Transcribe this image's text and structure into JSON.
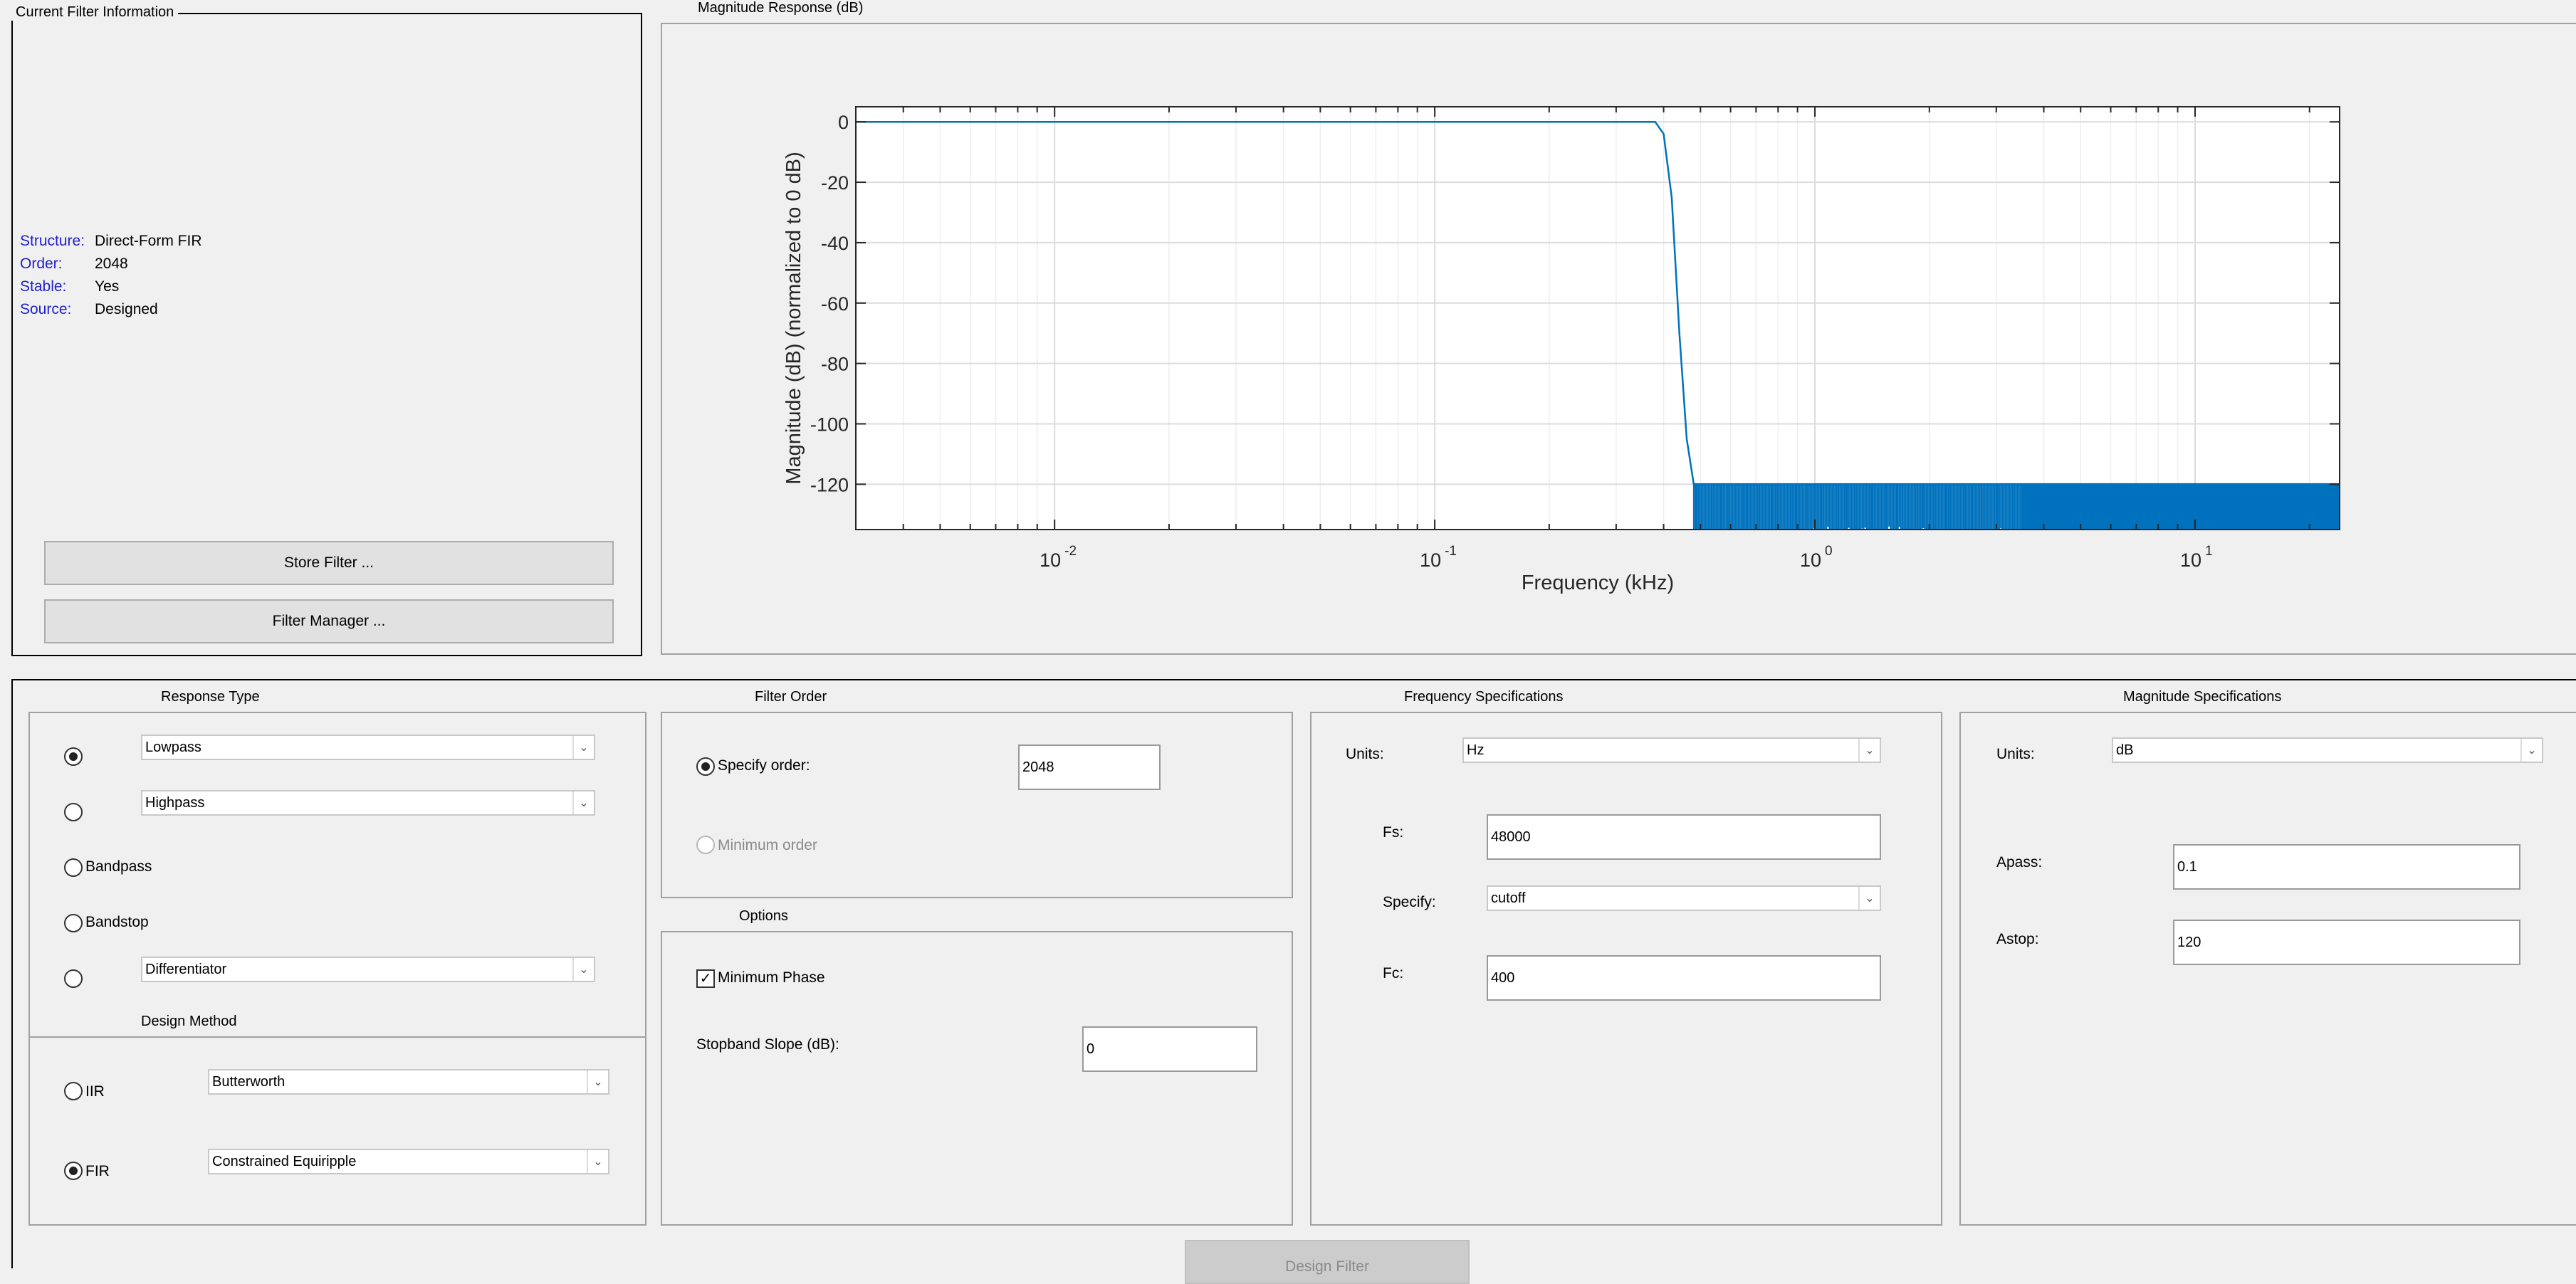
{
  "info_panel": {
    "title": "Current Filter Information",
    "rows": [
      {
        "label": "Structure:",
        "value": "Direct-Form FIR"
      },
      {
        "label": "Order:",
        "value": "2048"
      },
      {
        "label": "Stable:",
        "value": "Yes"
      },
      {
        "label": "Source:",
        "value": "Designed"
      }
    ],
    "store_button": "Store Filter ...",
    "manager_button": "Filter Manager ..."
  },
  "response_panel": {
    "title": "Magnitude Response (dB)"
  },
  "chart_data": {
    "type": "line",
    "xlabel": "Frequency (kHz)",
    "ylabel": "Magnitude (dB) (normalized to 0 dB)",
    "x_scale": "log",
    "xlim": [
      0.003,
      24
    ],
    "ylim": [
      -135,
      5
    ],
    "yticks": [
      0,
      -20,
      -40,
      -60,
      -80,
      -100,
      -120
    ],
    "xticks": [
      {
        "value": 0.01,
        "base": "10",
        "exp": "-2"
      },
      {
        "value": 0.1,
        "base": "10",
        "exp": "-1"
      },
      {
        "value": 1,
        "base": "10",
        "exp": "0"
      },
      {
        "value": 10,
        "base": "10",
        "exp": "1"
      }
    ],
    "grid": true,
    "color": "#0072bd",
    "passband": {
      "from": 0.003,
      "to": 0.38,
      "db": 0
    },
    "transition": [
      [
        0.38,
        0
      ],
      [
        0.4,
        -4
      ],
      [
        0.42,
        -25
      ],
      [
        0.44,
        -70
      ],
      [
        0.46,
        -105
      ],
      [
        0.48,
        -120
      ]
    ],
    "stopband": {
      "from": 0.48,
      "to": 24,
      "top_db": -120,
      "ripple_depth_db": 14
    }
  },
  "response_type": {
    "title": "Response Type",
    "lowpass": "Lowpass",
    "highpass": "Highpass",
    "bandpass": "Bandpass",
    "bandstop": "Bandstop",
    "differentiator": "Differentiator"
  },
  "design_method": {
    "title": "Design Method",
    "iir": "IIR",
    "iir_value": "Butterworth",
    "fir": "FIR",
    "fir_value": "Constrained Equiripple"
  },
  "filter_order": {
    "title": "Filter Order",
    "specify": "Specify order:",
    "specify_value": "2048",
    "minimum": "Minimum order"
  },
  "options": {
    "title": "Options",
    "min_phase": "Minimum Phase",
    "slope_label": "Stopband Slope (dB):",
    "slope_value": "0"
  },
  "freq_specs": {
    "title": "Frequency Specifications",
    "units_label": "Units:",
    "units_value": "Hz",
    "fs_label": "Fs:",
    "fs_value": "48000",
    "specify_label": "Specify:",
    "specify_value": "cutoff",
    "fc_label": "Fc:",
    "fc_value": "400"
  },
  "mag_specs": {
    "title": "Magnitude Specifications",
    "units_label": "Units:",
    "units_value": "dB",
    "apass_label": "Apass:",
    "apass_value": "0.1",
    "astop_label": "Astop:",
    "astop_value": "120"
  },
  "design_button": "Design Filter"
}
